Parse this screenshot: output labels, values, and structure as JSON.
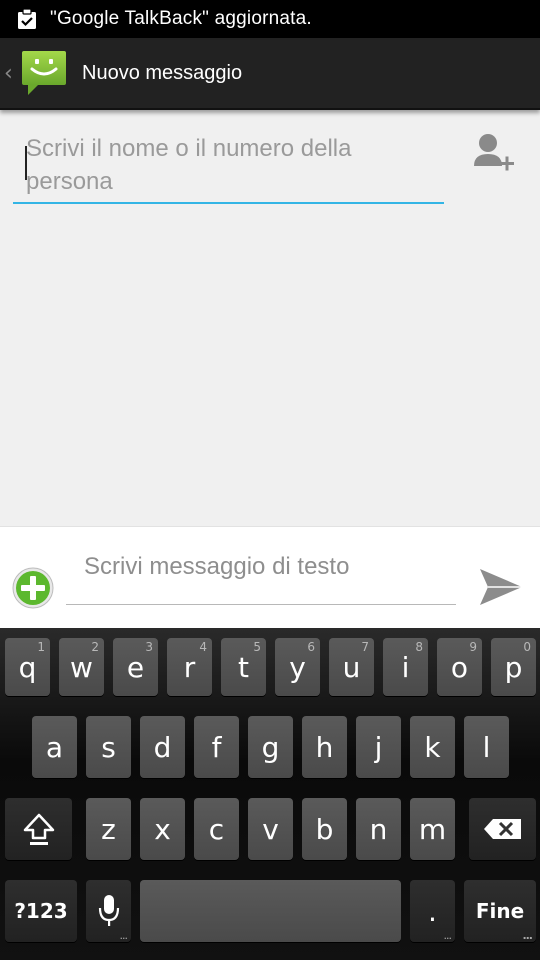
{
  "status_bar": {
    "notification_icon": "clipboard-check-icon",
    "text": "\"Google TalkBack\" aggiornata."
  },
  "action_bar": {
    "up_icon": "chevron-left-icon",
    "app_icon": "messaging-smiley-icon",
    "title": "Nuovo messaggio"
  },
  "recipient": {
    "placeholder": "Scrivi il nome o il numero della persona",
    "value": "",
    "add_contact_icon": "add-person-icon"
  },
  "compose": {
    "attach_icon": "plus-circle-icon",
    "placeholder": "Scrivi messaggio di testo",
    "value": "",
    "send_icon": "send-icon"
  },
  "keyboard": {
    "row1": [
      {
        "label": "q",
        "hint": "1"
      },
      {
        "label": "w",
        "hint": "2"
      },
      {
        "label": "e",
        "hint": "3"
      },
      {
        "label": "r",
        "hint": "4"
      },
      {
        "label": "t",
        "hint": "5"
      },
      {
        "label": "y",
        "hint": "6"
      },
      {
        "label": "u",
        "hint": "7"
      },
      {
        "label": "i",
        "hint": "8"
      },
      {
        "label": "o",
        "hint": "9"
      },
      {
        "label": "p",
        "hint": "0"
      }
    ],
    "row2": [
      "a",
      "s",
      "d",
      "f",
      "g",
      "h",
      "j",
      "k",
      "l"
    ],
    "row3": [
      "z",
      "x",
      "c",
      "v",
      "b",
      "n",
      "m"
    ],
    "shift_icon": "shift-icon",
    "backspace_icon": "backspace-icon",
    "symbols_label": "?123",
    "mic_icon": "microphone-icon",
    "period_label": ".",
    "done_label": "Fine"
  },
  "colors": {
    "accent": "#33b5e5",
    "actionbar": "#222222",
    "content_bg": "#f0f0f0",
    "attach_green": "#5cb82e"
  }
}
